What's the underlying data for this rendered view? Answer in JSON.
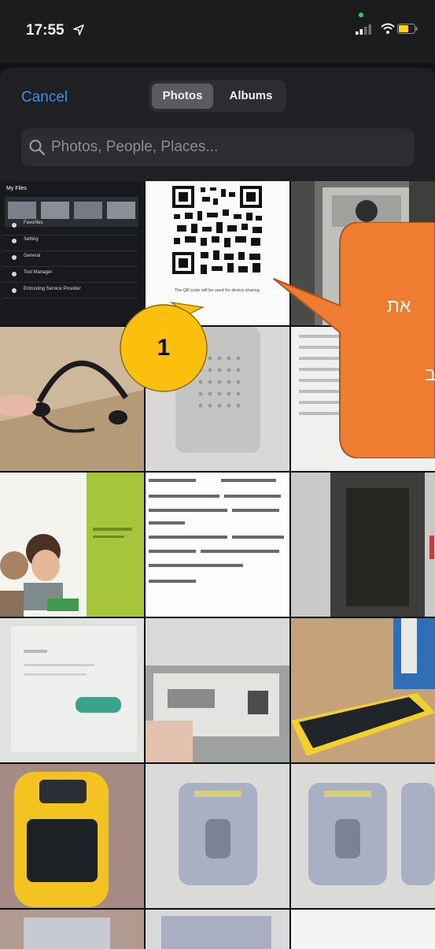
{
  "status_bar": {
    "time": "17:55",
    "icons": [
      "location-arrow-icon",
      "camera-in-use-dot",
      "cellular-signal-icon",
      "wifi-icon",
      "battery-icon"
    ],
    "battery_color": "#ffd60a"
  },
  "picker": {
    "cancel_label": "Cancel",
    "tabs": [
      {
        "label": "Photos",
        "selected": true
      },
      {
        "label": "Albums",
        "selected": false
      }
    ],
    "search": {
      "placeholder": "Photos, People, Places...",
      "value": ""
    },
    "accent_color": "#3a8ef0"
  },
  "thumb_qr": {
    "caption": "The QR code will be used for device sharing."
  },
  "thumb_myfiles": {
    "title": "My Files",
    "items": [
      "Favorites",
      "Setting",
      "General",
      "Tool Manager",
      "Entrusting Service Provider"
    ]
  },
  "annotations": {
    "step_number": "1",
    "step_circle_color": "#fbbf0d",
    "bubble_color": "#ef7d31",
    "bubble_fragments": [
      "את",
      "ב"
    ]
  }
}
